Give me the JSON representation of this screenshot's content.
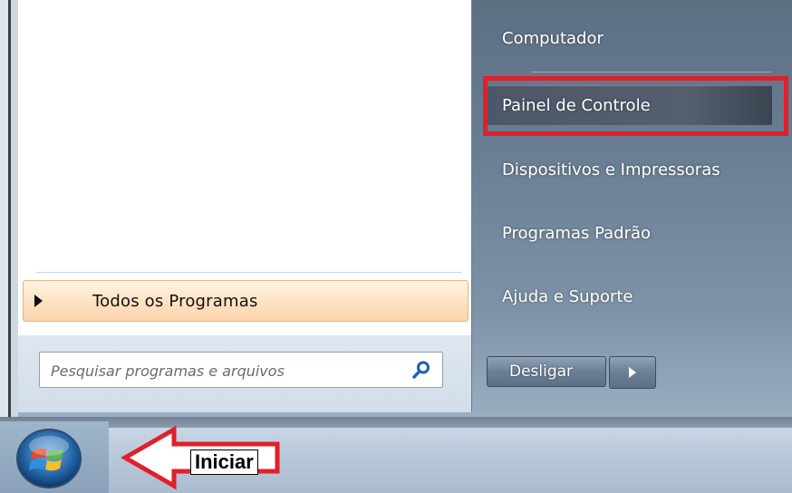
{
  "left_pane": {
    "all_programs_label": "Todos os Programas",
    "search_placeholder": "Pesquisar programas e arquivos"
  },
  "right_pane": {
    "items": [
      {
        "label": "Computador"
      },
      {
        "label": "Painel de Controle",
        "highlighted": true
      },
      {
        "label": "Dispositivos e Impressoras"
      },
      {
        "label": "Programas Padrão"
      },
      {
        "label": "Ajuda e Suporte"
      }
    ],
    "shutdown_label": "Desligar"
  },
  "annotation": {
    "label": "Iniciar",
    "arrow_color": "#e0202a",
    "highlight_color": "#e0202a"
  },
  "icons": [
    "search-icon",
    "triangle-right-icon",
    "chevron-right-icon",
    "windows-start-orb-icon"
  ]
}
